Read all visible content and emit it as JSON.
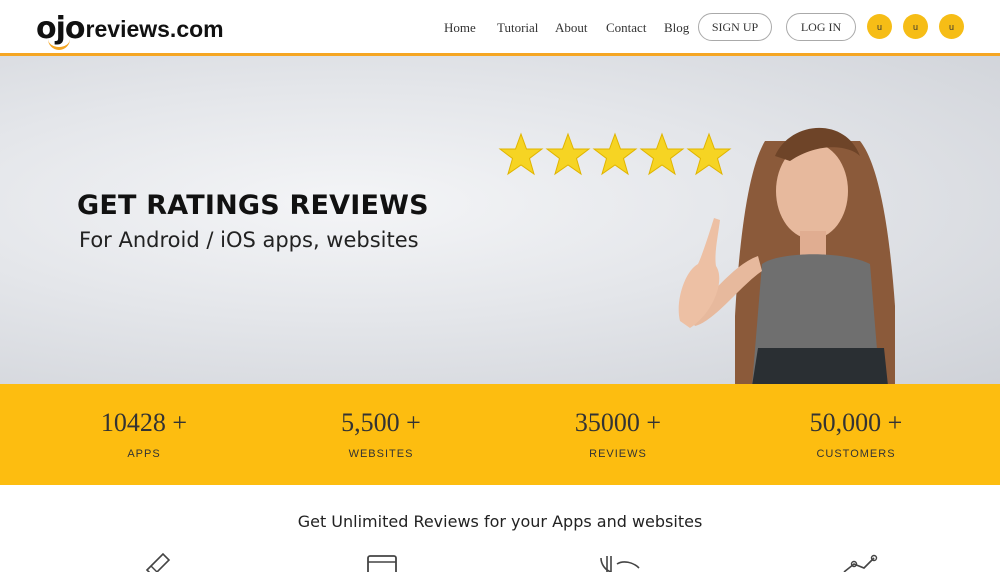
{
  "logo": {
    "part1": "oj",
    "part2": "o",
    "part3": "reviews.com"
  },
  "nav": {
    "home": "Home",
    "tutorial": "Tutorial",
    "about": "About",
    "contact": "Contact",
    "blog": "Blog",
    "signup": "SIGN UP",
    "login": "LOG IN"
  },
  "social": [
    "u",
    "u",
    "u"
  ],
  "hero": {
    "title": "GET RATINGS REVIEWS",
    "subtitle": "For Android / iOS apps, websites",
    "stars": 5
  },
  "stats": [
    {
      "num": "10428 +",
      "label": "APPS"
    },
    {
      "num": "5,500 +",
      "label": "WEBSITES"
    },
    {
      "num": "35000 +",
      "label": "REVIEWS"
    },
    {
      "num": "50,000 +",
      "label": "CUSTOMERS"
    }
  ],
  "section": {
    "title": "Get Unlimited Reviews for your Apps and websites"
  },
  "features": [
    {
      "icon": "pencil-icon"
    },
    {
      "icon": "browser-icon"
    },
    {
      "icon": "phone-icon"
    },
    {
      "icon": "chart-icon"
    }
  ],
  "colors": {
    "accent": "#fdbd10",
    "orange": "#f5a623"
  }
}
